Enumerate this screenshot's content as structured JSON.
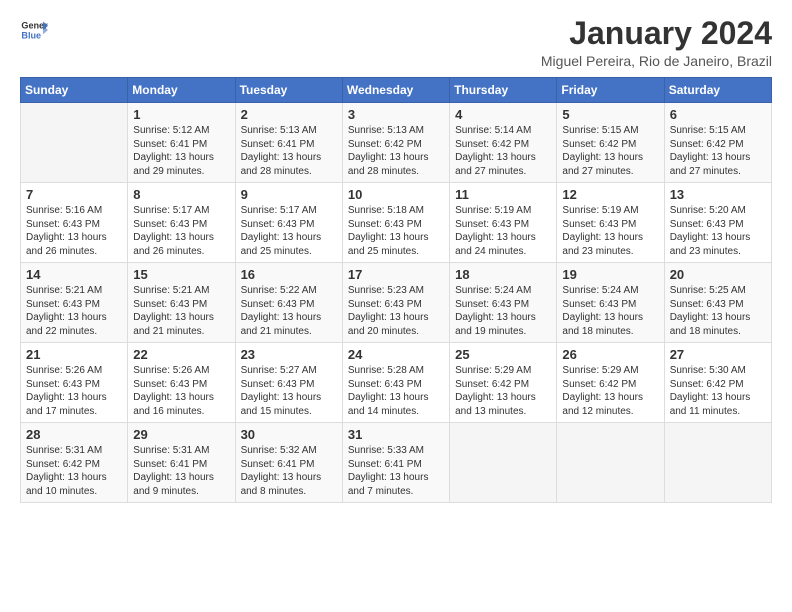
{
  "logo": {
    "line1": "General",
    "line2": "Blue"
  },
  "title": "January 2024",
  "location": "Miguel Pereira, Rio de Janeiro, Brazil",
  "days_of_week": [
    "Sunday",
    "Monday",
    "Tuesday",
    "Wednesday",
    "Thursday",
    "Friday",
    "Saturday"
  ],
  "weeks": [
    [
      {
        "day": "",
        "info": ""
      },
      {
        "day": "1",
        "info": "Sunrise: 5:12 AM\nSunset: 6:41 PM\nDaylight: 13 hours\nand 29 minutes."
      },
      {
        "day": "2",
        "info": "Sunrise: 5:13 AM\nSunset: 6:41 PM\nDaylight: 13 hours\nand 28 minutes."
      },
      {
        "day": "3",
        "info": "Sunrise: 5:13 AM\nSunset: 6:42 PM\nDaylight: 13 hours\nand 28 minutes."
      },
      {
        "day": "4",
        "info": "Sunrise: 5:14 AM\nSunset: 6:42 PM\nDaylight: 13 hours\nand 27 minutes."
      },
      {
        "day": "5",
        "info": "Sunrise: 5:15 AM\nSunset: 6:42 PM\nDaylight: 13 hours\nand 27 minutes."
      },
      {
        "day": "6",
        "info": "Sunrise: 5:15 AM\nSunset: 6:42 PM\nDaylight: 13 hours\nand 27 minutes."
      }
    ],
    [
      {
        "day": "7",
        "info": "Sunrise: 5:16 AM\nSunset: 6:43 PM\nDaylight: 13 hours\nand 26 minutes."
      },
      {
        "day": "8",
        "info": "Sunrise: 5:17 AM\nSunset: 6:43 PM\nDaylight: 13 hours\nand 26 minutes."
      },
      {
        "day": "9",
        "info": "Sunrise: 5:17 AM\nSunset: 6:43 PM\nDaylight: 13 hours\nand 25 minutes."
      },
      {
        "day": "10",
        "info": "Sunrise: 5:18 AM\nSunset: 6:43 PM\nDaylight: 13 hours\nand 25 minutes."
      },
      {
        "day": "11",
        "info": "Sunrise: 5:19 AM\nSunset: 6:43 PM\nDaylight: 13 hours\nand 24 minutes."
      },
      {
        "day": "12",
        "info": "Sunrise: 5:19 AM\nSunset: 6:43 PM\nDaylight: 13 hours\nand 23 minutes."
      },
      {
        "day": "13",
        "info": "Sunrise: 5:20 AM\nSunset: 6:43 PM\nDaylight: 13 hours\nand 23 minutes."
      }
    ],
    [
      {
        "day": "14",
        "info": "Sunrise: 5:21 AM\nSunset: 6:43 PM\nDaylight: 13 hours\nand 22 minutes."
      },
      {
        "day": "15",
        "info": "Sunrise: 5:21 AM\nSunset: 6:43 PM\nDaylight: 13 hours\nand 21 minutes."
      },
      {
        "day": "16",
        "info": "Sunrise: 5:22 AM\nSunset: 6:43 PM\nDaylight: 13 hours\nand 21 minutes."
      },
      {
        "day": "17",
        "info": "Sunrise: 5:23 AM\nSunset: 6:43 PM\nDaylight: 13 hours\nand 20 minutes."
      },
      {
        "day": "18",
        "info": "Sunrise: 5:24 AM\nSunset: 6:43 PM\nDaylight: 13 hours\nand 19 minutes."
      },
      {
        "day": "19",
        "info": "Sunrise: 5:24 AM\nSunset: 6:43 PM\nDaylight: 13 hours\nand 18 minutes."
      },
      {
        "day": "20",
        "info": "Sunrise: 5:25 AM\nSunset: 6:43 PM\nDaylight: 13 hours\nand 18 minutes."
      }
    ],
    [
      {
        "day": "21",
        "info": "Sunrise: 5:26 AM\nSunset: 6:43 PM\nDaylight: 13 hours\nand 17 minutes."
      },
      {
        "day": "22",
        "info": "Sunrise: 5:26 AM\nSunset: 6:43 PM\nDaylight: 13 hours\nand 16 minutes."
      },
      {
        "day": "23",
        "info": "Sunrise: 5:27 AM\nSunset: 6:43 PM\nDaylight: 13 hours\nand 15 minutes."
      },
      {
        "day": "24",
        "info": "Sunrise: 5:28 AM\nSunset: 6:43 PM\nDaylight: 13 hours\nand 14 minutes."
      },
      {
        "day": "25",
        "info": "Sunrise: 5:29 AM\nSunset: 6:42 PM\nDaylight: 13 hours\nand 13 minutes."
      },
      {
        "day": "26",
        "info": "Sunrise: 5:29 AM\nSunset: 6:42 PM\nDaylight: 13 hours\nand 12 minutes."
      },
      {
        "day": "27",
        "info": "Sunrise: 5:30 AM\nSunset: 6:42 PM\nDaylight: 13 hours\nand 11 minutes."
      }
    ],
    [
      {
        "day": "28",
        "info": "Sunrise: 5:31 AM\nSunset: 6:42 PM\nDaylight: 13 hours\nand 10 minutes."
      },
      {
        "day": "29",
        "info": "Sunrise: 5:31 AM\nSunset: 6:41 PM\nDaylight: 13 hours\nand 9 minutes."
      },
      {
        "day": "30",
        "info": "Sunrise: 5:32 AM\nSunset: 6:41 PM\nDaylight: 13 hours\nand 8 minutes."
      },
      {
        "day": "31",
        "info": "Sunrise: 5:33 AM\nSunset: 6:41 PM\nDaylight: 13 hours\nand 7 minutes."
      },
      {
        "day": "",
        "info": ""
      },
      {
        "day": "",
        "info": ""
      },
      {
        "day": "",
        "info": ""
      }
    ]
  ]
}
